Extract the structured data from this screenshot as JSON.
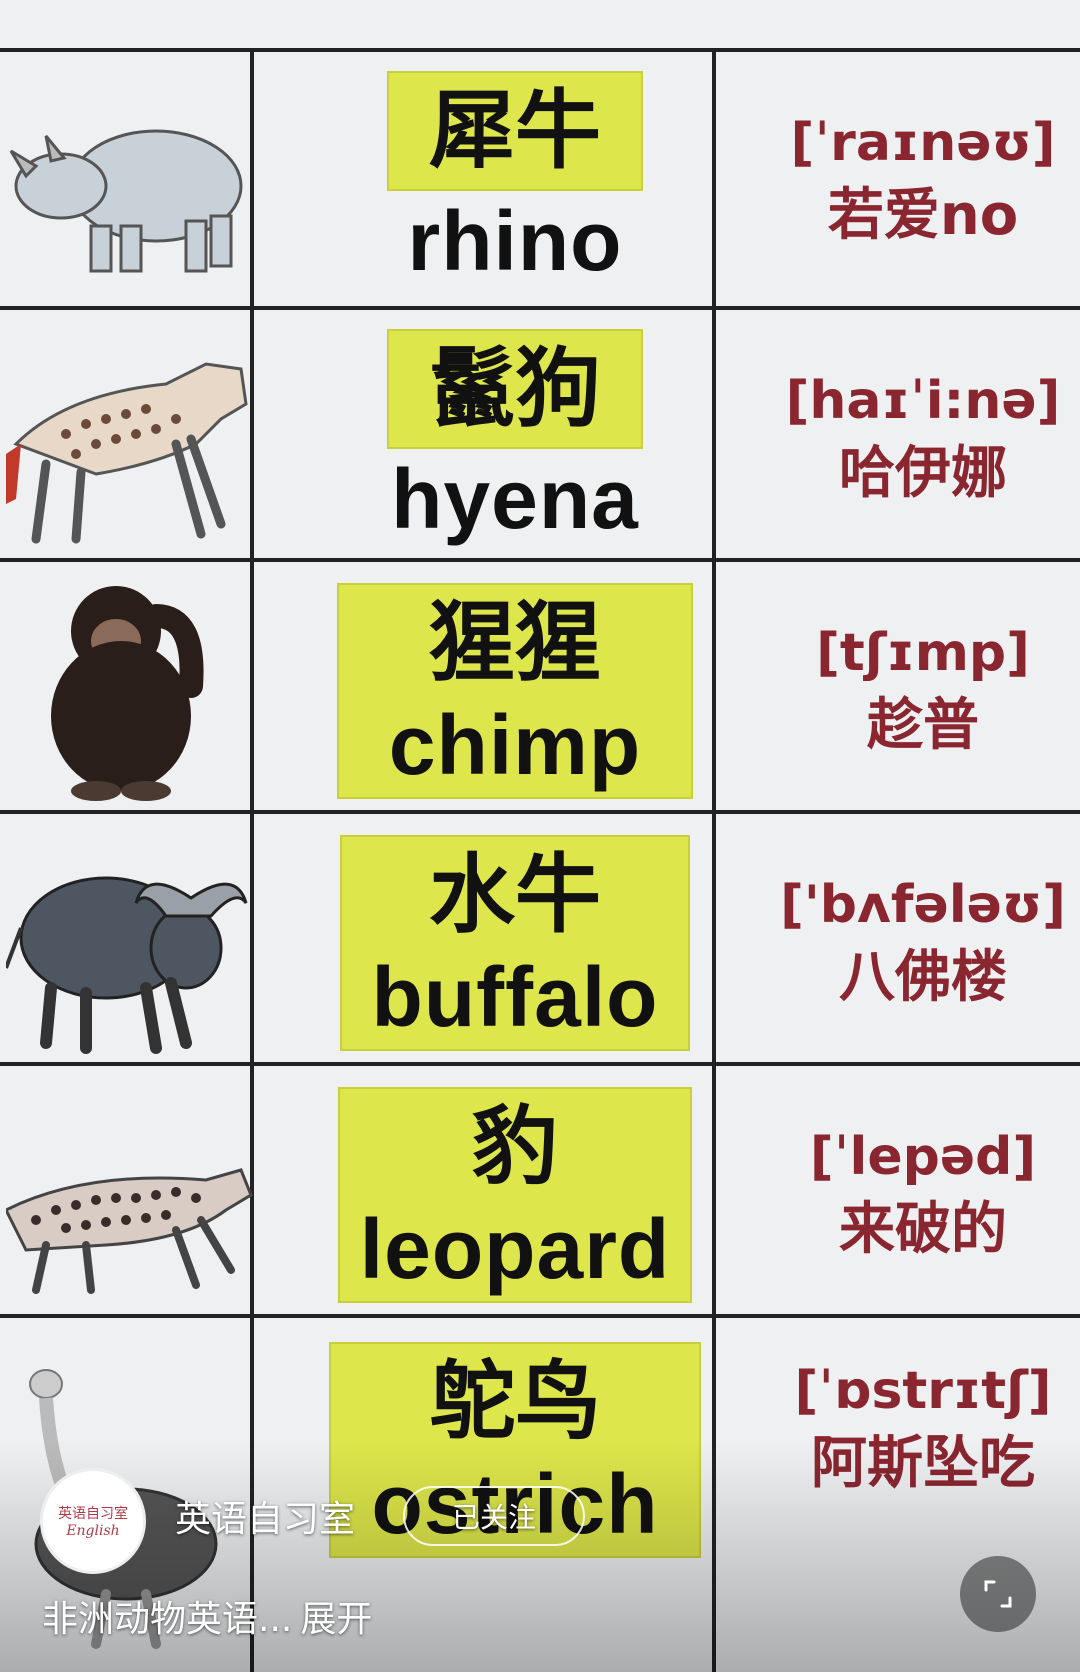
{
  "rows": [
    {
      "icon": "rhino-illustration",
      "cn": "犀牛",
      "en": "rhino",
      "ipa": "[ˈraɪnəʊ]",
      "hint": "若爱no"
    },
    {
      "icon": "hyena-illustration",
      "cn": "鬣狗",
      "en": "hyena",
      "ipa": "[haɪˈi:nə]",
      "hint": "哈伊娜"
    },
    {
      "icon": "chimp-illustration",
      "cn": "猩猩",
      "en": "chimp",
      "ipa": "[tʃɪmp]",
      "hint": "趁普"
    },
    {
      "icon": "buffalo-illustration",
      "cn": "水牛",
      "en": "buffalo",
      "ipa": "['bʌfələʊ]",
      "hint": "八佛楼"
    },
    {
      "icon": "leopard-illustration",
      "cn": "豹",
      "en": "leopard",
      "ipa": "[ˈlepəd]",
      "hint": "来破的"
    },
    {
      "icon": "ostrich-illustration",
      "cn": "鸵鸟",
      "en": "ostrich",
      "ipa": "[ˈɒstrɪtʃ]",
      "hint": "阿斯坠吃"
    }
  ],
  "overlay": {
    "avatar_line1": "英语自习室",
    "avatar_line2": "English",
    "account_name": "英语自习室",
    "follow_label": "已关注",
    "caption": "非洲动物英语...",
    "expand_label": "展开",
    "expand_icon": "fullscreen-icon"
  },
  "colors": {
    "highlight": "#dde64a",
    "pronunciation": "#8a2630",
    "board": "#eef0f2",
    "grid": "#222222"
  }
}
